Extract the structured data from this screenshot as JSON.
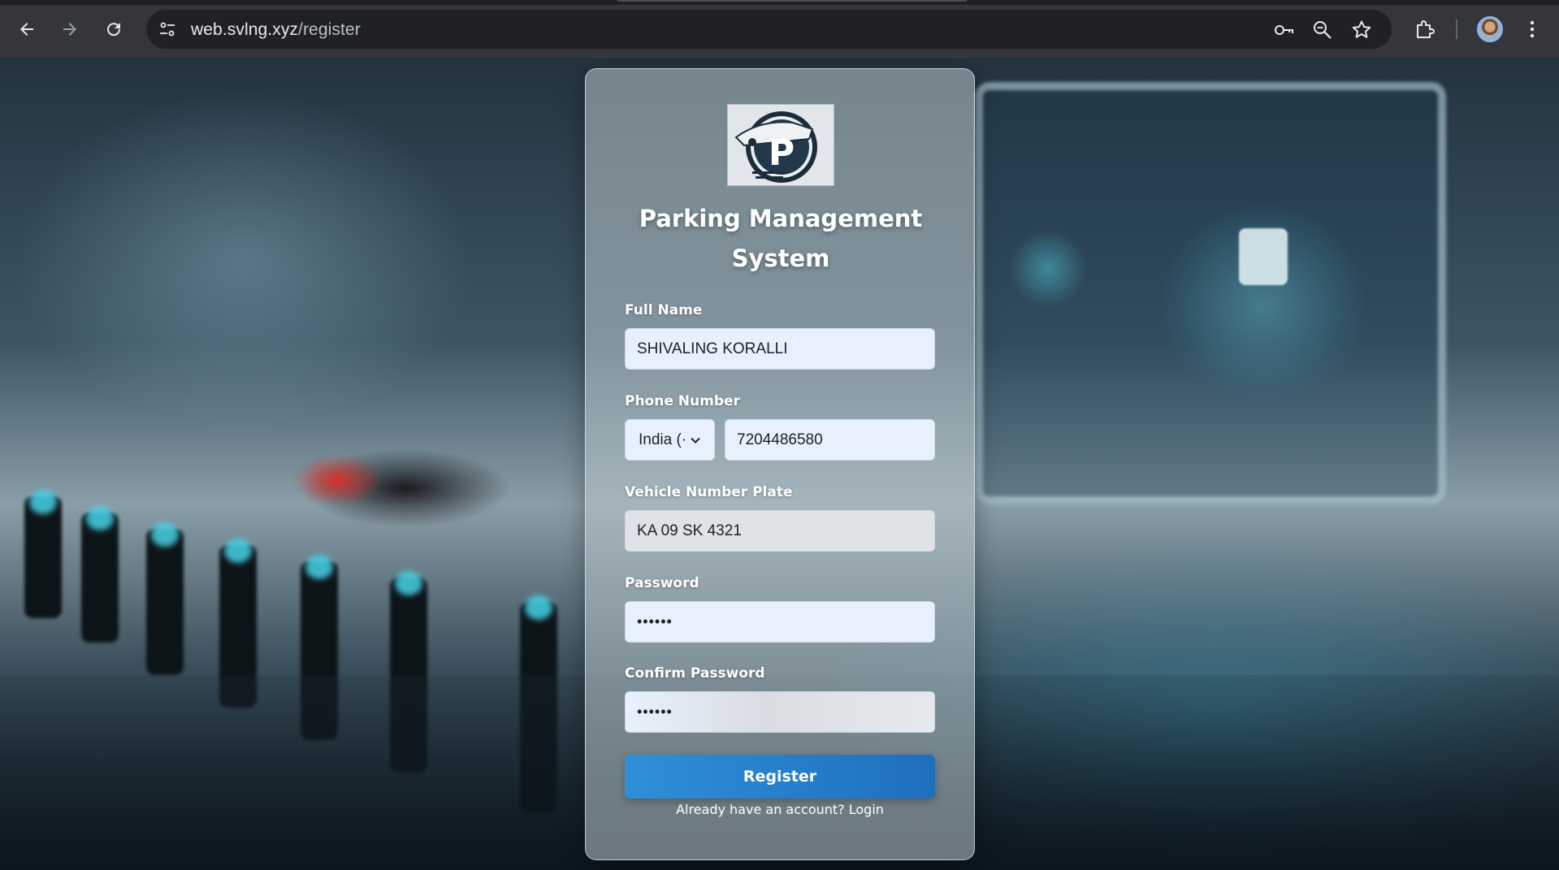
{
  "browser": {
    "url_domain": "web.svlng.xyz",
    "url_path": "/register",
    "icons": [
      "back-icon",
      "forward-icon",
      "reload-icon",
      "site-info-icon",
      "password-key-icon",
      "zoom-icon",
      "bookmark-star-icon",
      "extensions-icon",
      "profile-avatar",
      "menu-kebab-icon"
    ]
  },
  "form": {
    "title_line1": "Parking Management",
    "title_line2": "System",
    "full_name": {
      "label": "Full Name",
      "value": "SHIVALING KORALLI"
    },
    "phone": {
      "label": "Phone Number",
      "country_selected": "India (·",
      "value": "7204486580"
    },
    "vehicle": {
      "label": "Vehicle Number Plate",
      "value": "KA 09 SK 4321"
    },
    "password": {
      "label": "Password",
      "value": "••••••"
    },
    "confirm_password": {
      "label": "Confirm Password",
      "value": "••••••"
    },
    "register_label": "Register",
    "login_prompt": "Already have an account?",
    "login_link": "Login"
  },
  "colors": {
    "button": "#2f8fd8",
    "input_autofill": "#e8f0fe",
    "chrome_bar": "#35363a"
  }
}
